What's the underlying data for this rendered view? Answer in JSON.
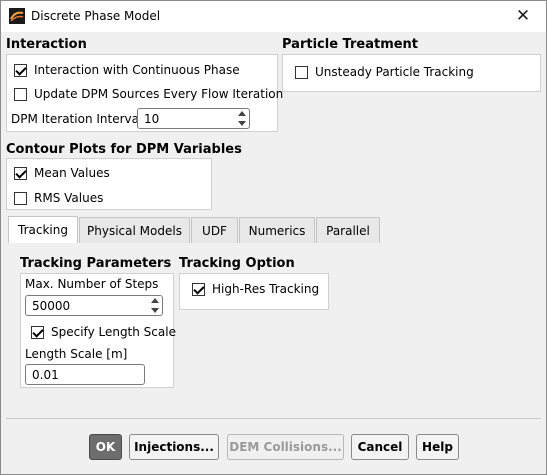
{
  "window": {
    "title": "Discrete Phase Model",
    "close_glyph": "✕"
  },
  "interaction": {
    "title": "Interaction",
    "continuous_phase": {
      "label": "Interaction with Continuous Phase",
      "checked": true
    },
    "update_sources": {
      "label": "Update DPM Sources Every Flow Iteration",
      "checked": false
    },
    "iteration_interval": {
      "label": "DPM Iteration Interval",
      "value": "10"
    }
  },
  "particle_treatment": {
    "title": "Particle Treatment",
    "unsteady": {
      "label": "Unsteady Particle Tracking",
      "checked": false
    }
  },
  "contour_plots": {
    "title": "Contour Plots for DPM Variables",
    "mean_values": {
      "label": "Mean Values",
      "checked": true
    },
    "rms_values": {
      "label": "RMS Values",
      "checked": false
    }
  },
  "tabs": [
    {
      "label": "Tracking",
      "active": true
    },
    {
      "label": "Physical Models",
      "active": false
    },
    {
      "label": "UDF",
      "active": false
    },
    {
      "label": "Numerics",
      "active": false
    },
    {
      "label": "Parallel",
      "active": false
    }
  ],
  "tracking": {
    "parameters_title": "Tracking Parameters",
    "max_steps_label": "Max. Number of Steps",
    "max_steps_value": "50000",
    "specify_length": {
      "label": "Specify Length Scale",
      "checked": true
    },
    "length_scale_label": "Length Scale [m]",
    "length_scale_value": "0.01",
    "option_title": "Tracking Option",
    "high_res": {
      "label": "High-Res Tracking",
      "checked": true
    }
  },
  "buttons": {
    "ok": "OK",
    "injections": "Injections...",
    "dem_collisions": "DEM Collisions...",
    "cancel": "Cancel",
    "help": "Help"
  }
}
